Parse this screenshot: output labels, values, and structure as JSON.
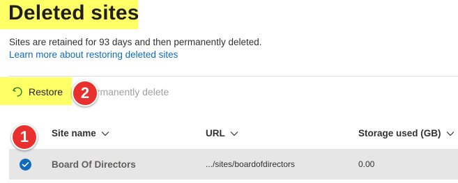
{
  "page": {
    "title": "Deleted sites",
    "description": "Sites are retained for 93 days and then permanently deleted.",
    "learn_more": "Learn more about restoring deleted sites"
  },
  "toolbar": {
    "restore_label": "Restore",
    "permanently_delete_label": "ermanently delete",
    "restore_icon": "restore-icon"
  },
  "annotations": {
    "badge_1": "1",
    "badge_2": "2"
  },
  "colors": {
    "highlight": "#ffff66",
    "badge": "#e8312f",
    "accent": "#0f6cbd",
    "selected_row": "#e6e6e6"
  },
  "table": {
    "columns": [
      {
        "label": "Site name"
      },
      {
        "label": "URL"
      },
      {
        "label": "Storage used (GB)"
      }
    ],
    "rows": [
      {
        "selected": true,
        "site_name": "Board Of Directors",
        "url": ".../sites/boardofdirectors",
        "storage": "0.00"
      }
    ]
  }
}
